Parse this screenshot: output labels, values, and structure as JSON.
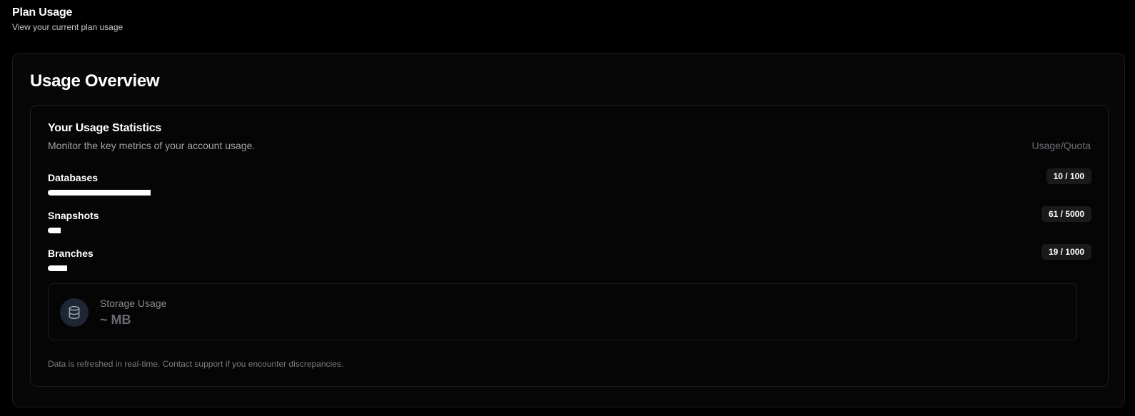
{
  "page": {
    "title": "Plan Usage",
    "subtitle": "View your current plan usage"
  },
  "overview": {
    "title": "Usage Overview"
  },
  "stats": {
    "title": "Your Usage Statistics",
    "description": "Monitor the key metrics of your account usage.",
    "quota_header": "Usage/Quota",
    "metrics": [
      {
        "label": "Databases",
        "value": "10 / 100",
        "fraction": 0.1
      },
      {
        "label": "Snapshots",
        "value": "61 / 5000",
        "fraction": 0.0122
      },
      {
        "label": "Branches",
        "value": "19 / 1000",
        "fraction": 0.019
      }
    ]
  },
  "storage": {
    "label": "Storage Usage",
    "value": "~ MB",
    "icon": "database-icon"
  },
  "footer": {
    "note": "Data is refreshed in real-time. Contact support if you encounter discrepancies."
  },
  "colors": {
    "background": "#000000",
    "card": "#070707",
    "bar_fill": "#ffffff",
    "badge_bg": "#1a1a1a",
    "icon_bg": "#1f2633",
    "muted_text": "#a3a3a8"
  }
}
